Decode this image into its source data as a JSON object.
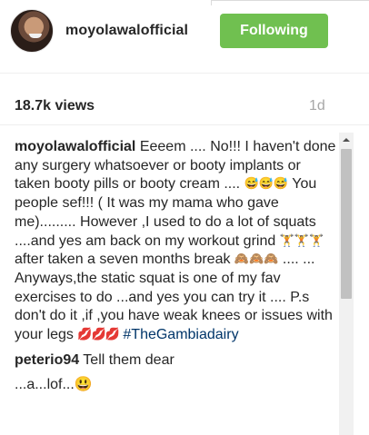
{
  "post": {
    "username": "moyolawalofficial",
    "follow_label": "Following",
    "views": "18.7k views",
    "time_ago": "1d"
  },
  "comments": [
    {
      "author": "moyolawalofficial",
      "text_1": "Eeeem .... No!!! I haven't done any surgery whatsoever or booty implants or taken booty pills or booty cream .... ",
      "emoji_1": "😅😅😅",
      "text_2": " You people sef!!! ( It was my mama who gave me)......... However ,I used to do a lot of squats ....and yes am back on my workout grind ",
      "emoji_2": "🏋🏋🏋",
      "text_3": " after taken a seven months break ",
      "emoji_3": "🙈🙈🙈",
      "text_4": " .... ... Anyways,the static squat is one of my fav exercises to do ...and yes you can try it .... P.s don't do it ,if ,you have weak knees or issues with your legs ",
      "emoji_4": "💋💋💋",
      "hashtag": "#TheGambiadairy"
    },
    {
      "author": "peterio94",
      "text": "Tell them dear"
    },
    {
      "author": "",
      "text": "...a...lof...😃"
    }
  ],
  "icons": {
    "scroll_up": "chevron-up-icon"
  }
}
